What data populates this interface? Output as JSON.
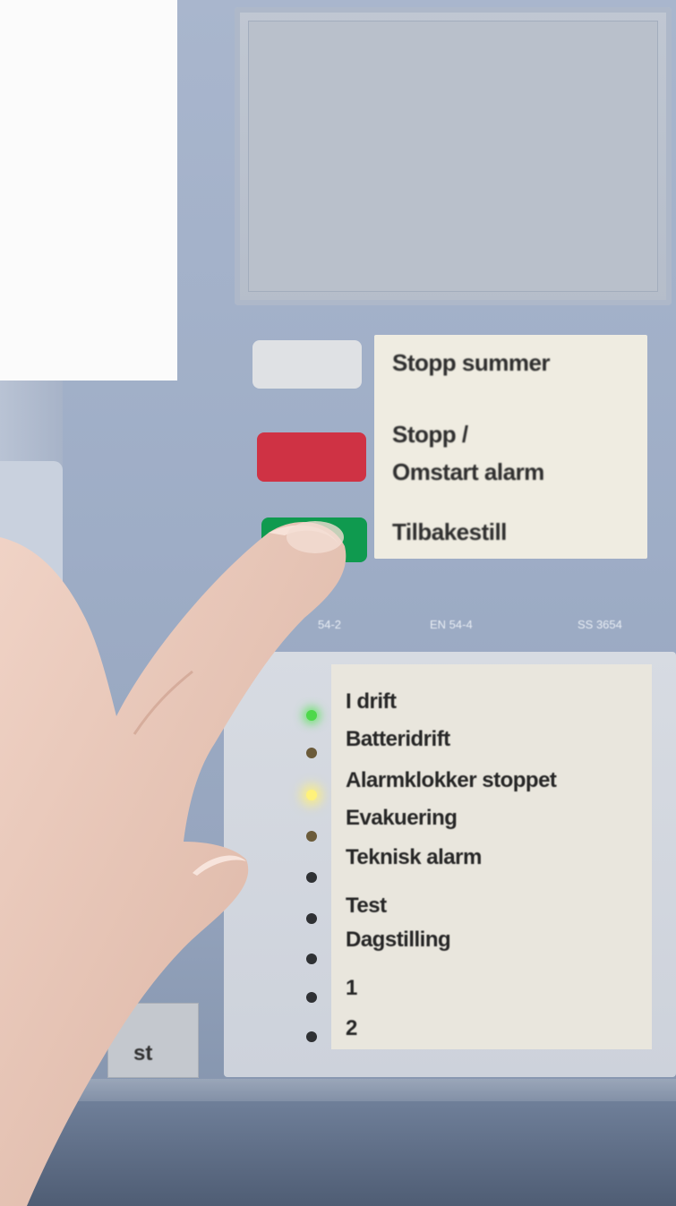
{
  "panel": {
    "buttons": [
      {
        "label": "Stopp summer",
        "color": "#dfe1e4"
      },
      {
        "label_line1": "Stopp /",
        "label_line2": "Omstart alarm",
        "color": "#cf3244"
      },
      {
        "label": "Tilbakestill",
        "color": "#0f9a4f"
      }
    ],
    "norms": [
      "54-2",
      "EN 54-4",
      "SS 3654"
    ]
  },
  "indicators": [
    {
      "label": "I drift",
      "state": "on",
      "color": "#4ed84b"
    },
    {
      "label": "Batteridrift",
      "state": "off",
      "color": "#6b5b3a"
    },
    {
      "label": "Alarmklokker stoppet",
      "state": "on",
      "color": "#fff27a"
    },
    {
      "label": "Evakuering",
      "state": "off",
      "color": "#6b5b3a"
    },
    {
      "label": "Teknisk alarm",
      "state": "off",
      "color": "#2f3134"
    },
    {
      "label": "Test",
      "state": "off",
      "color": "#2f3134"
    },
    {
      "label": "Dagstilling",
      "state": "off",
      "color": "#2f3134"
    },
    {
      "label": "1",
      "state": "off",
      "color": "#2f3134"
    },
    {
      "label": "2",
      "state": "off",
      "color": "#2f3134"
    }
  ],
  "bottom_key": {
    "label": "st"
  }
}
